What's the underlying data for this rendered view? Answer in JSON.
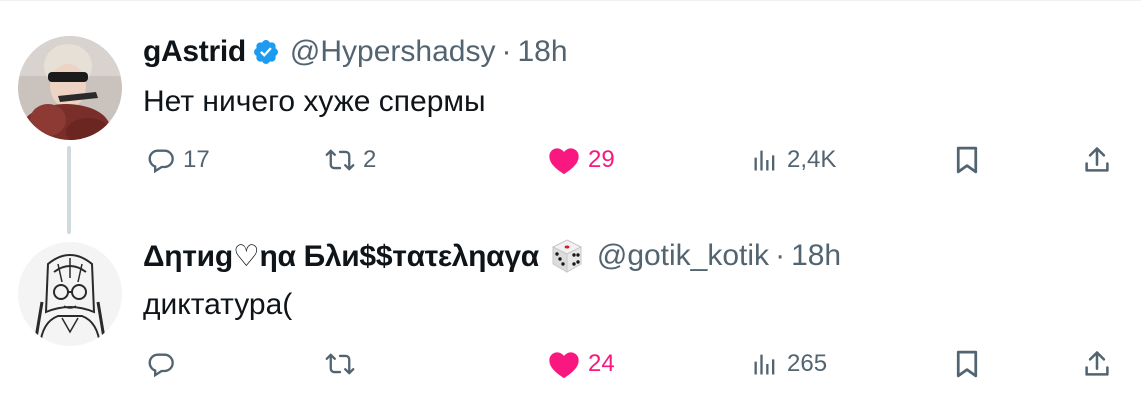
{
  "colors": {
    "text": "#0f1419",
    "secondary": "#536471",
    "like": "#f91880",
    "verified": "#1d9bf0",
    "thread_line": "#cfd9de"
  },
  "tweets": [
    {
      "name": "gAstrid",
      "verified": true,
      "handle": "@Hypershadsy",
      "separator": "·",
      "time": "18h",
      "text": "Нет ничего хуже спермы",
      "replies": "17",
      "retweets": "2",
      "likes": "29",
      "liked": true,
      "views": "2,4K"
    },
    {
      "name": "Δηтиg♡ηα Бλи$$тατεληαγα",
      "emoji": "game-die-icon",
      "handle": "@gotik_kotik",
      "separator": "·",
      "time": "18h",
      "text": "диктатура(",
      "replies": "",
      "retweets": "",
      "likes": "24",
      "liked": true,
      "views": "265"
    }
  ],
  "icons": [
    "reply-icon",
    "retweet-icon",
    "heart-icon",
    "views-icon",
    "bookmark-icon",
    "share-icon"
  ]
}
